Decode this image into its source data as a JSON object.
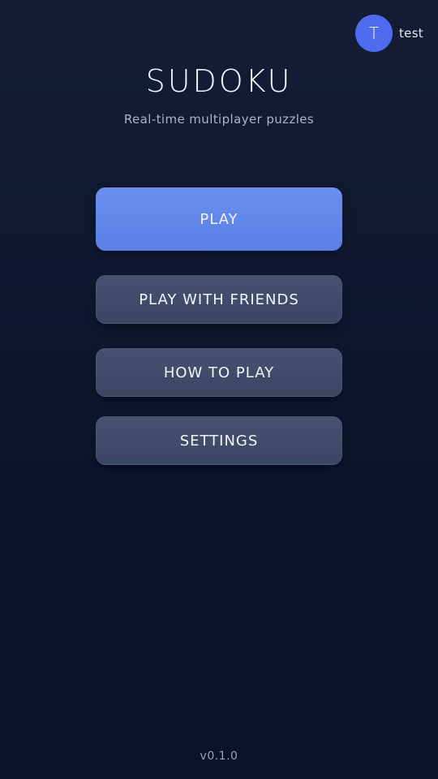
{
  "profile": {
    "initial": "T",
    "username": "test",
    "avatar_color": "#4f6cf0"
  },
  "header": {
    "title": "SUDOKU",
    "subtitle": "Real-time multiplayer puzzles"
  },
  "menu": {
    "play_label": "PLAY",
    "play_with_friends_label": "PLAY WITH FRIENDS",
    "how_to_play_label": "HOW TO PLAY",
    "settings_label": "SETTINGS"
  },
  "footer": {
    "version": "v0.1.0"
  },
  "colors": {
    "primary_button": "#5b80e6",
    "secondary_button": "#3b4663",
    "background": "#0f1830"
  }
}
